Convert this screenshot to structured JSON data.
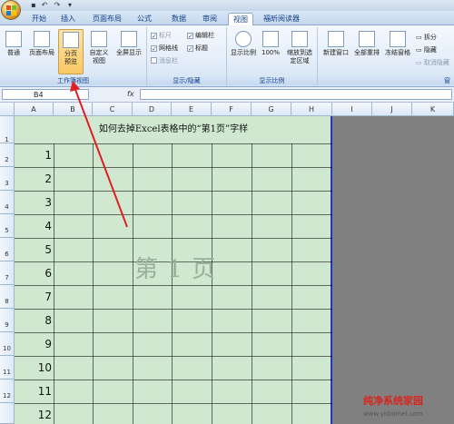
{
  "tabs": [
    "开始",
    "插入",
    "页面布局",
    "公式",
    "数据",
    "审阅",
    "视图",
    "福昕阅读器"
  ],
  "active_tab": "视图",
  "ribbon": {
    "workbook_views": {
      "label": "工作簿视图",
      "buttons": [
        "普通",
        "页面布局",
        "分页预览",
        "自定义视图",
        "全屏显示"
      ]
    },
    "show_hide": {
      "label": "显示/隐藏",
      "items": [
        {
          "label": "标尺",
          "checked": true,
          "enabled": false
        },
        {
          "label": "网格线",
          "checked": true,
          "enabled": true
        },
        {
          "label": "消息栏",
          "checked": false,
          "enabled": false
        },
        {
          "label": "编辑栏",
          "checked": true,
          "enabled": true
        },
        {
          "label": "标题",
          "checked": true,
          "enabled": true
        }
      ]
    },
    "zoom": {
      "label": "显示比例",
      "buttons": [
        "显示比例",
        "100%",
        "缩放到选定区域"
      ]
    },
    "window": {
      "label": "窗",
      "buttons": [
        "新建窗口",
        "全部重排",
        "冻结窗格"
      ],
      "small_buttons": [
        "拆分",
        "隐藏",
        "取消隐藏"
      ]
    }
  },
  "formula_bar": {
    "name_box": "B4",
    "fx": "fx",
    "value": ""
  },
  "columns": [
    "A",
    "B",
    "C",
    "D",
    "E",
    "F",
    "G",
    "H",
    "I",
    "J",
    "K"
  ],
  "rows": [
    "1",
    "2",
    "3",
    "4",
    "5",
    "6",
    "7",
    "8",
    "9",
    "10",
    "11",
    "12"
  ],
  "title_cell": "如何去掉Excel表格中的“第1页”字样",
  "numbers": [
    "1",
    "2",
    "3",
    "4",
    "5",
    "6",
    "7",
    "8",
    "9",
    "10",
    "11",
    "12"
  ],
  "page_watermark": "第 1 页",
  "site_watermark": {
    "title": "纯净系统家园",
    "url": "www.yidaimei.com"
  },
  "colors": {
    "print_area": "#cfe8cf",
    "page_break_line": "#1a3bbf",
    "arrow": "#e02020",
    "pressed": "#fbc864"
  }
}
